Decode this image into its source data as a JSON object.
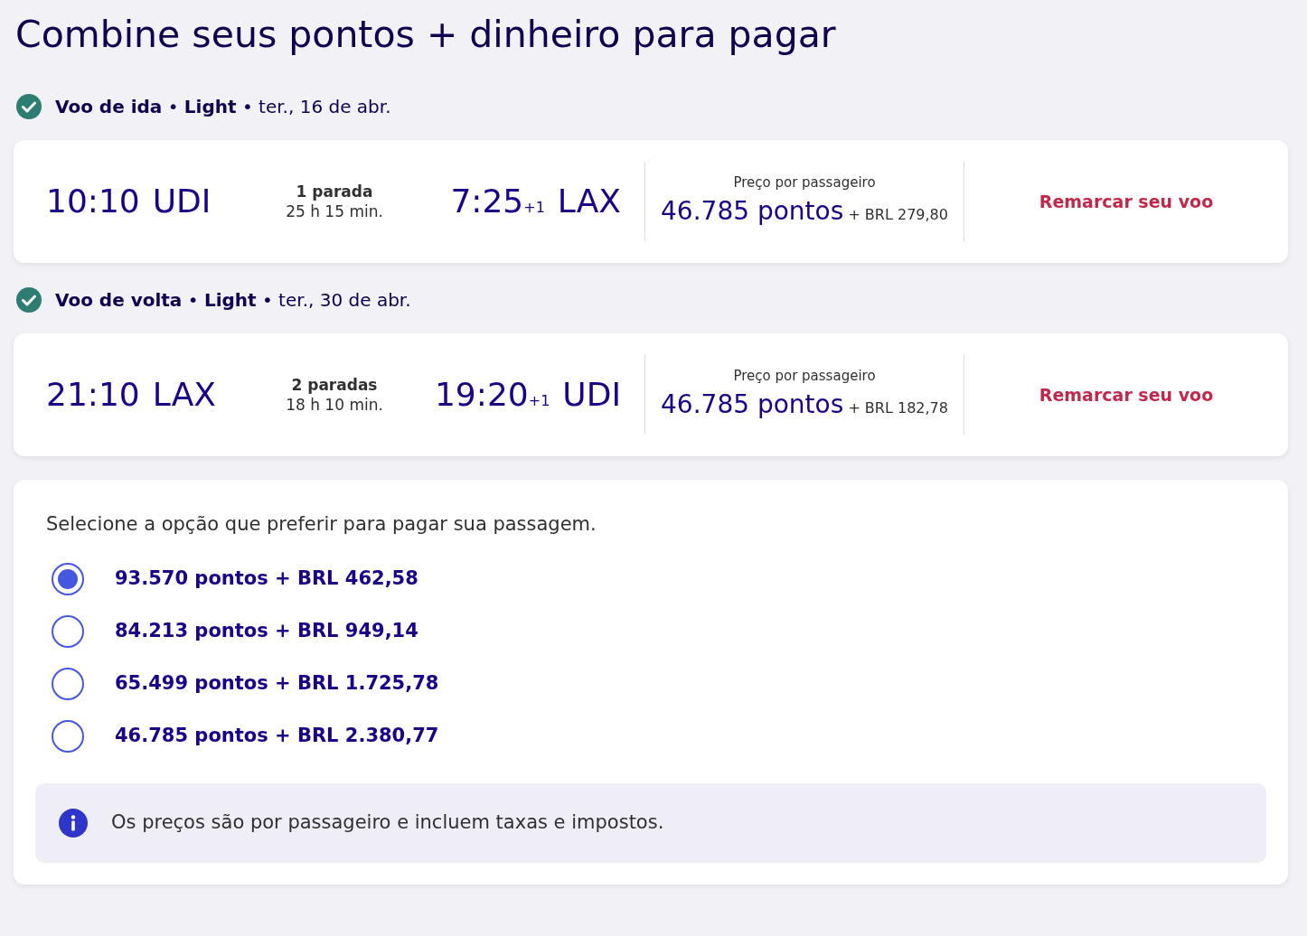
{
  "title": "Combine seus pontos + dinheiro para pagar",
  "flights": [
    {
      "heading": "**Voo de ida** • **Light** • ter., 16 de abr.",
      "confirmed": true,
      "depart_time": "10:10",
      "depart_airport": "UDI",
      "stops": "1 parada",
      "duration": "25 h 15 min.",
      "arrive_time": "7:25",
      "day_offset": "+1",
      "arrive_airport": "LAX",
      "price_label": "Preço por passageiro",
      "points": "46.785 pontos",
      "cash": "+ BRL 279,80",
      "action": "Remarcar seu voo"
    },
    {
      "heading": "**Voo de volta** • **Light** • ter., 30 de abr.",
      "confirmed": true,
      "depart_time": "21:10",
      "depart_airport": "LAX",
      "stops": "2 paradas",
      "duration": "18 h 10 min.",
      "arrive_time": "19:20",
      "day_offset": "+1",
      "arrive_airport": "UDI",
      "price_label": "Preço por passageiro",
      "points": "46.785 pontos",
      "cash": "+ BRL 182,78",
      "action": "Remarcar seu voo"
    }
  ],
  "payment": {
    "prompt": "Selecione a opção que preferir para pagar sua passagem.",
    "options": [
      {
        "label": "93.570 pontos + BRL 462,58",
        "selected": true
      },
      {
        "label": "84.213 pontos + BRL 949,14",
        "selected": false
      },
      {
        "label": "65.499 pontos + BRL 1.725,78",
        "selected": false
      },
      {
        "label": "46.785 pontos + BRL 2.380,77",
        "selected": false
      }
    ],
    "info": "Os preços são por passageiro e incluem taxas e impostos."
  }
}
